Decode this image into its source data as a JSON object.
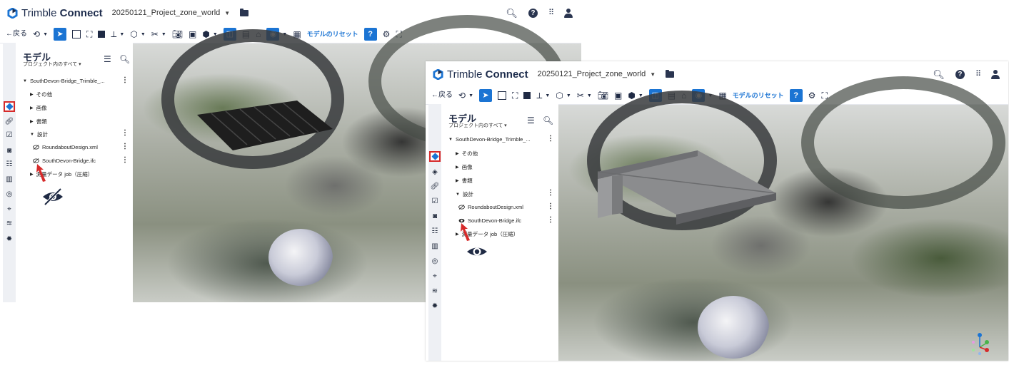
{
  "app": {
    "brand_light": "Trimble",
    "brand_bold": "Connect",
    "project": "20250121_Project_zone_world"
  },
  "toolbar": {
    "back_label": "←戻る",
    "reset_label": "モデルのリセット"
  },
  "tree": {
    "title": "モデル",
    "scope": "プロジェクト内のすべて ▾",
    "root": "SouthDevon-Bridge_Trimble_...",
    "folders": [
      "その他",
      "画像",
      "書類",
      "設計"
    ],
    "files": [
      "RoundaboutDesign.xml",
      "SouthDevon-Bridge.ifc"
    ],
    "survey": "測量データ job（圧縮）"
  },
  "states": {
    "before": "SouthDevon-Bridge.ifc hidden",
    "after": "SouthDevon-Bridge.ifc visible"
  },
  "colors": {
    "accent": "#1b74d3",
    "highlight": "#d62a2a",
    "brand": "#1d2c4c"
  },
  "icons": {
    "hidden": "eye-slash-icon",
    "visible": "eye-icon"
  }
}
